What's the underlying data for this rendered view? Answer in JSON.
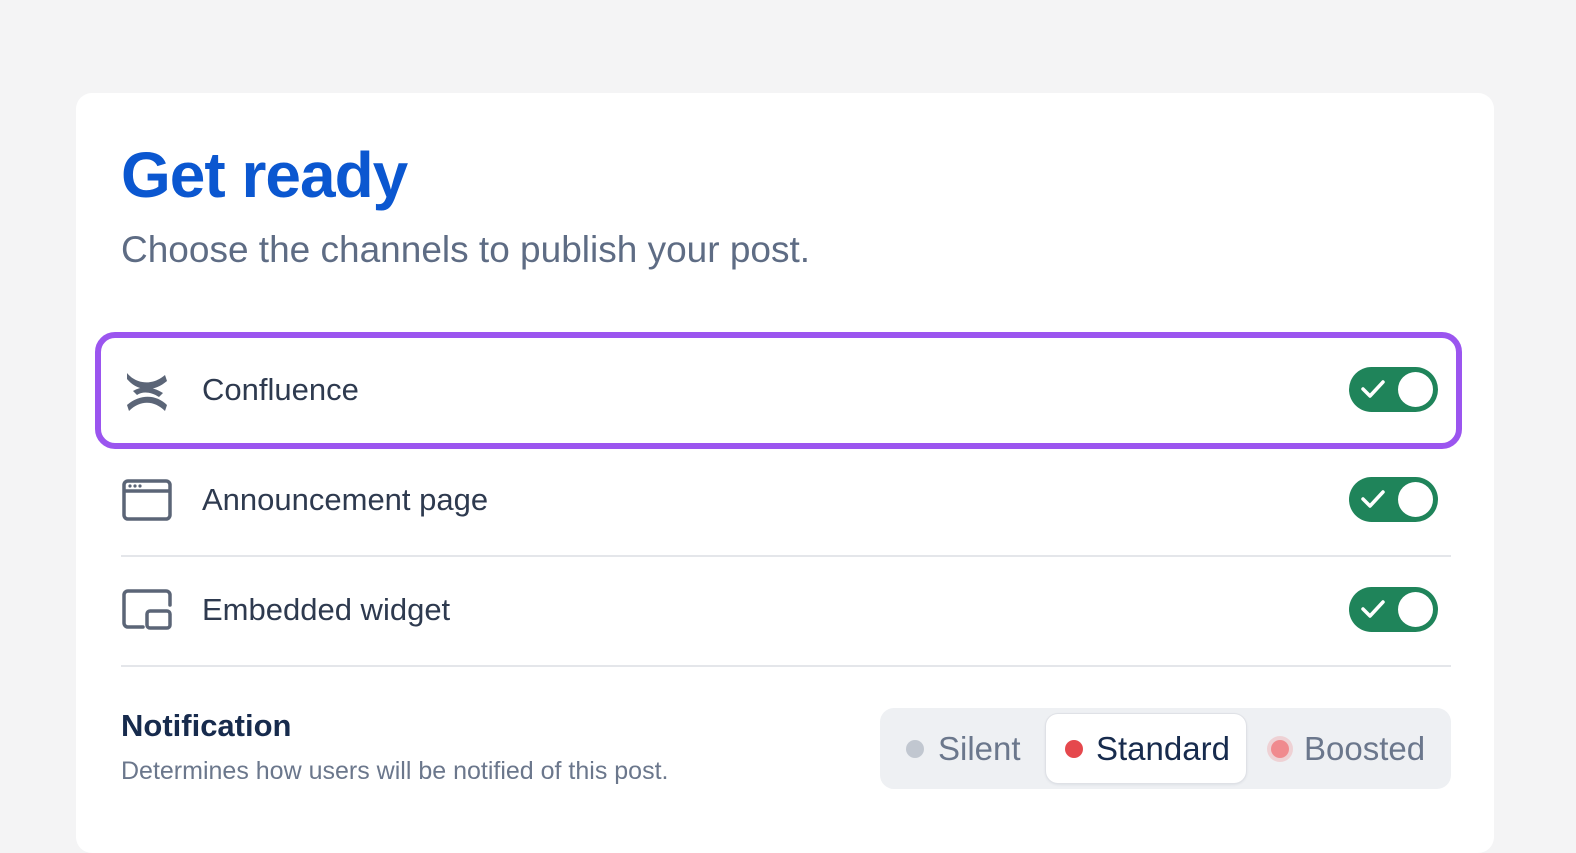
{
  "header": {
    "title": "Get ready",
    "subtitle": "Choose the channels to publish your post."
  },
  "channels": [
    {
      "label": "Confluence",
      "icon": "confluence-logo-icon",
      "enabled": true,
      "highlighted": true
    },
    {
      "label": "Announcement page",
      "icon": "browser-window-icon",
      "enabled": true,
      "highlighted": false
    },
    {
      "label": "Embedded widget",
      "icon": "embedded-widget-icon",
      "enabled": true,
      "highlighted": false
    }
  ],
  "notification": {
    "title": "Notification",
    "description": "Determines how users will be notified of this post.",
    "options": [
      {
        "label": "Silent",
        "dot_color": "#c1c7d0",
        "selected": false
      },
      {
        "label": "Standard",
        "dot_color": "#e5484d",
        "selected": true
      },
      {
        "label": "Boosted",
        "dot_color": "#f08a8e",
        "selected": false
      }
    ]
  },
  "colors": {
    "title": "#0b57d0",
    "toggle_on": "#1f845a",
    "highlight": "#9b55ef",
    "background": "#f4f4f5",
    "card": "#ffffff"
  }
}
